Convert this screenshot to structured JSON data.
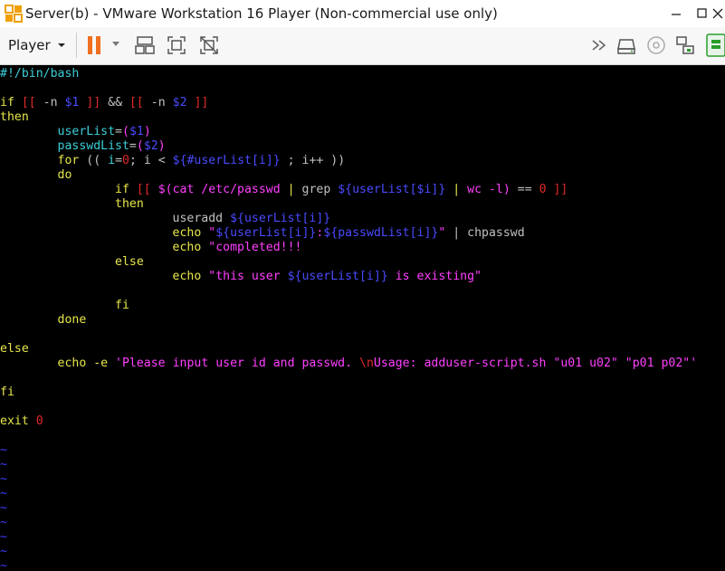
{
  "window": {
    "title": "Server(b) - VMware Workstation 16 Player (Non-commercial use only)"
  },
  "toolbar": {
    "player_label": "Player"
  },
  "icons": [
    "vmware-logo-icon",
    "minimize-icon",
    "maximize-icon",
    "close-icon",
    "pause-icon",
    "dropdown-arrow-icon",
    "send-ctrl-alt-del-icon",
    "fit-guest-icon",
    "unity-icon",
    "forward-icon",
    "hard-disk-icon",
    "cd-icon",
    "network-icon",
    "vm-settings-icon"
  ],
  "colors": {
    "background": "#000000",
    "keyword": "#ff40ff",
    "bracket": "#e22828",
    "variable": "#4a4aff",
    "identifier": "#3ccfd8",
    "tilde": "#3c3cff"
  },
  "code_lines": [
    [
      [
        "#!/bin/bash",
        "c-cyan"
      ]
    ],
    [],
    [
      [
        "if ",
        "c-yel"
      ],
      [
        "[[",
        "c-red"
      ],
      [
        " -n ",
        "c-w"
      ],
      [
        "$1",
        "c-blue"
      ],
      [
        " ]]",
        "c-red"
      ],
      [
        " && ",
        "c-w"
      ],
      [
        "[[",
        "c-red"
      ],
      [
        " -n ",
        "c-w"
      ],
      [
        "$2",
        "c-blue"
      ],
      [
        " ]]",
        "c-red"
      ]
    ],
    [
      [
        "then",
        "c-yel"
      ]
    ],
    [
      [
        "        userList",
        "c-cyan"
      ],
      [
        "=",
        "c-w"
      ],
      [
        "(",
        "c-pur"
      ],
      [
        "$1",
        "c-blue"
      ],
      [
        ")",
        "c-pur"
      ]
    ],
    [
      [
        "        passwdList",
        "c-cyan"
      ],
      [
        "=",
        "c-w"
      ],
      [
        "(",
        "c-pur"
      ],
      [
        "$2",
        "c-blue"
      ],
      [
        ")",
        "c-pur"
      ]
    ],
    [
      [
        "        for",
        "c-yel"
      ],
      [
        " (( ",
        "c-w"
      ],
      [
        "i",
        "c-cyan"
      ],
      [
        "=",
        "c-w"
      ],
      [
        "0",
        "c-red"
      ],
      [
        "; i < ",
        "c-w"
      ],
      [
        "${#userList[i]}",
        "c-blue"
      ],
      [
        " ; i++ ))",
        "c-w"
      ]
    ],
    [
      [
        "        do",
        "c-yel"
      ]
    ],
    [
      [
        "                if ",
        "c-yel"
      ],
      [
        "[[",
        "c-red"
      ],
      [
        " $(",
        "c-pur"
      ],
      [
        "cat /etc/passwd ",
        "c-pur"
      ],
      [
        "|",
        "c-yel"
      ],
      [
        " grep ",
        "c-w"
      ],
      [
        "${userList[$i]}",
        "c-blue"
      ],
      [
        " ",
        "c-w"
      ],
      [
        "|",
        "c-yel"
      ],
      [
        " wc -l",
        "c-pur"
      ],
      [
        ")",
        "c-pur"
      ],
      [
        " == ",
        "c-w"
      ],
      [
        "0",
        "c-red"
      ],
      [
        " ]]",
        "c-red"
      ]
    ],
    [
      [
        "                then",
        "c-yel"
      ]
    ],
    [
      [
        "                        useradd ",
        "c-w"
      ],
      [
        "${userList[i]}",
        "c-blue"
      ]
    ],
    [
      [
        "                        echo ",
        "c-yel"
      ],
      [
        "\"",
        "c-pur"
      ],
      [
        "${userList[i]}",
        "c-blue"
      ],
      [
        ":",
        "c-pur"
      ],
      [
        "${passwdList[i]}",
        "c-blue"
      ],
      [
        "\"",
        "c-pur"
      ],
      [
        " | chpasswd",
        "c-w"
      ]
    ],
    [
      [
        "                        echo ",
        "c-yel"
      ],
      [
        "\"completed!!!",
        "c-pur"
      ]
    ],
    [
      [
        "                else",
        "c-yel"
      ]
    ],
    [
      [
        "                        echo ",
        "c-yel"
      ],
      [
        "\"this user ",
        "c-pur"
      ],
      [
        "${userList[i]}",
        "c-blue"
      ],
      [
        " is existing\"",
        "c-pur"
      ]
    ],
    [],
    [
      [
        "                fi",
        "c-yel"
      ]
    ],
    [
      [
        "        done",
        "c-yel"
      ]
    ],
    [],
    [
      [
        "else",
        "c-yel"
      ]
    ],
    [
      [
        "        echo -e ",
        "c-yel"
      ],
      [
        "'Please input user id and passwd. ",
        "c-pur"
      ],
      [
        "\\n",
        "c-red"
      ],
      [
        "Usage: adduser-script.sh \"u01 u02\" \"p01 p02\"'",
        "c-pur"
      ]
    ],
    [],
    [
      [
        "fi",
        "c-yel"
      ]
    ],
    [],
    [
      [
        "exit ",
        "c-yel"
      ],
      [
        "0",
        "c-red"
      ]
    ],
    [],
    [
      [
        "~",
        "c-tilde"
      ]
    ],
    [
      [
        "~",
        "c-tilde"
      ]
    ],
    [
      [
        "~",
        "c-tilde"
      ]
    ],
    [
      [
        "~",
        "c-tilde"
      ]
    ],
    [
      [
        "~",
        "c-tilde"
      ]
    ],
    [
      [
        "~",
        "c-tilde"
      ]
    ],
    [
      [
        "~",
        "c-tilde"
      ]
    ],
    [
      [
        "~",
        "c-tilde"
      ]
    ],
    [
      [
        "~",
        "c-tilde"
      ]
    ]
  ]
}
